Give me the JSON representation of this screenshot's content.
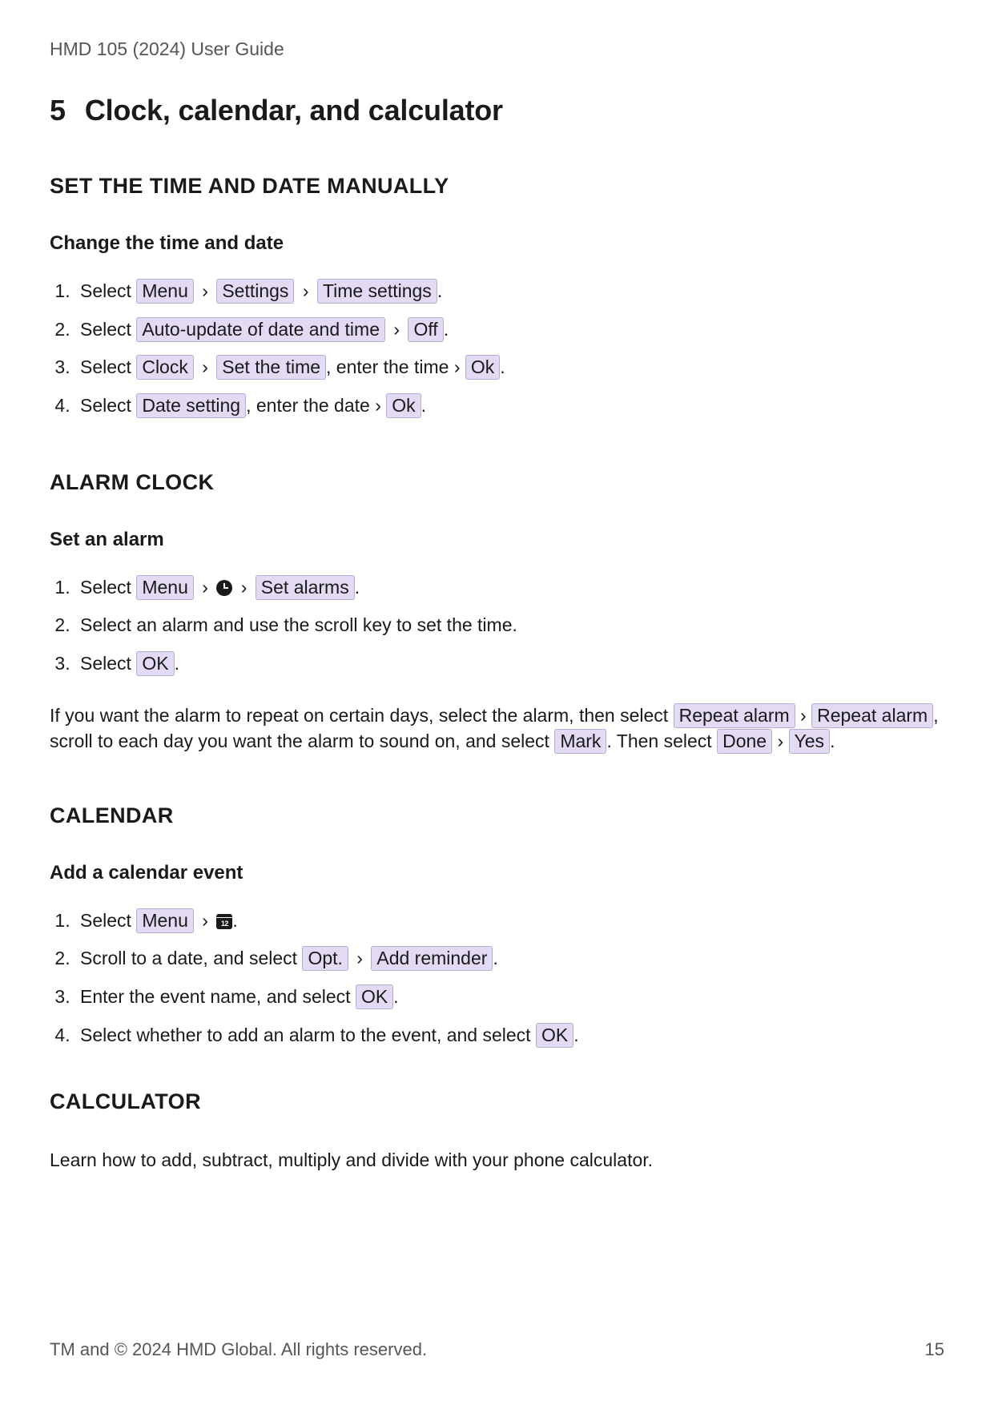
{
  "header": {
    "doc_title": "HMD 105 (2024) User Guide"
  },
  "chapter": {
    "number": "5",
    "title": "Clock, calendar, and calculator"
  },
  "sections": {
    "time_date": {
      "heading": "SET THE TIME AND DATE MANUALLY",
      "sub": "Change the time and date",
      "steps": {
        "s1": {
          "pre": "Select ",
          "b1": "Menu",
          "b2": "Settings",
          "b3": "Time settings",
          "post": "."
        },
        "s2": {
          "pre": "Select ",
          "b1": "Auto-update of date and time",
          "b2": "Off",
          "post": "."
        },
        "s3": {
          "pre": "Select ",
          "b1": "Clock",
          "b2": "Set the time",
          "mid": ", enter the time ›",
          "b3": "Ok",
          "post": "."
        },
        "s4": {
          "pre": "Select ",
          "b1": "Date setting",
          "mid": ", enter the date ›",
          "b2": "Ok",
          "post": "."
        }
      }
    },
    "alarm": {
      "heading": "ALARM CLOCK",
      "sub": "Set an alarm",
      "steps": {
        "s1": {
          "pre": "Select ",
          "b1": "Menu",
          "b2": "Set alarms",
          "post": "."
        },
        "s2": {
          "text": "Select an alarm and use the scroll key to set the time."
        },
        "s3": {
          "pre": "Select ",
          "b1": "OK",
          "post": "."
        }
      },
      "para": {
        "t1": "If you want the alarm to repeat on certain days, select the alarm, then select ",
        "b1": "Repeat alarm",
        "t2": " › ",
        "b2": "Repeat alarm",
        "t3": ", scroll to each day you want the alarm to sound on, and select ",
        "b3": "Mark",
        "t4": ". Then select ",
        "b4": "Done",
        "t5": " › ",
        "b5": "Yes",
        "t6": "."
      }
    },
    "calendar": {
      "heading": "CALENDAR",
      "sub": "Add a calendar event",
      "steps": {
        "s1": {
          "pre": "Select ",
          "b1": "Menu",
          "post": "."
        },
        "s2": {
          "pre": "Scroll to a date, and select ",
          "b1": "Opt.",
          "b2": "Add reminder",
          "post": "."
        },
        "s3": {
          "pre": "Enter the event name, and select ",
          "b1": "OK",
          "post": "."
        },
        "s4": {
          "pre": "Select whether to add an alarm to the event, and select ",
          "b1": "OK",
          "post": "."
        }
      }
    },
    "calculator": {
      "heading": "CALCULATOR",
      "para": "Learn how to add, subtract, multiply and divide with your phone calculator."
    }
  },
  "footer": {
    "copyright": "TM and © 2024 HMD Global.  All rights reserved.",
    "page": "15"
  },
  "glyphs": {
    "chev": "›"
  }
}
